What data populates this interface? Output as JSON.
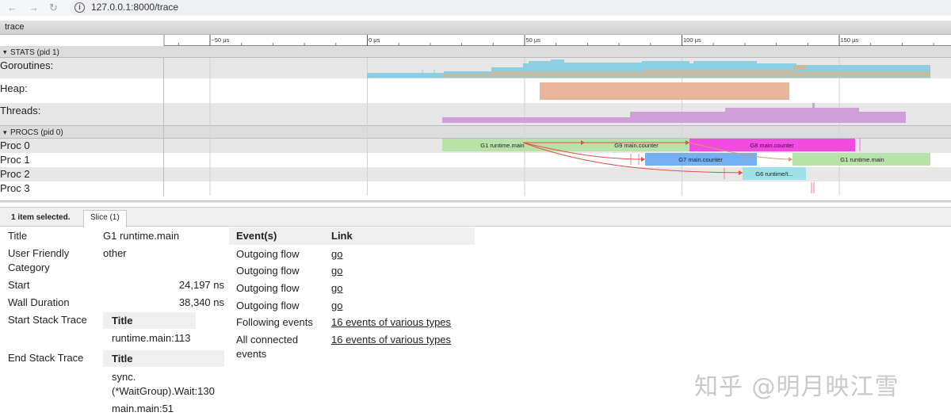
{
  "browser": {
    "url": "127.0.0.1:8000/trace",
    "back_icon": "arrow-left-icon",
    "forward_icon": "arrow-right-icon",
    "reload_icon": "reload-icon",
    "info_icon": "info-icon"
  },
  "trace_title": "trace",
  "ruler": {
    "ticks": [
      {
        "label": "−50 μs",
        "value": -50
      },
      {
        "label": "0 μs",
        "value": 0
      },
      {
        "label": "50 μs",
        "value": 50
      },
      {
        "label": "100 μs",
        "value": 100
      },
      {
        "label": "150 μs",
        "value": 150
      }
    ]
  },
  "stats_header": "STATS (pid 1)",
  "stats_rows": [
    "Goroutines:",
    "Heap:",
    "Threads:"
  ],
  "procs_header": "PROCS (pid 0)",
  "proc_rows": [
    "Proc 0",
    "Proc 1",
    "Proc 2",
    "Proc 3"
  ],
  "slices": [
    {
      "label": "G1 runtime.main",
      "row": 0,
      "color": "#b7e2a8"
    },
    {
      "label": "G9 main.counter",
      "row": 0,
      "color": "#b7e2a8"
    },
    {
      "label": "G8 main.counter",
      "row": 0,
      "color": "#f24be0"
    },
    {
      "label": "G7 main.counter",
      "row": 1,
      "color": "#74b0f2"
    },
    {
      "label": "G1 runtime.main",
      "row": 1,
      "color": "#b7e2a8"
    },
    {
      "label": "G6 runtime/t...",
      "row": 2,
      "color": "#9ee0e6"
    }
  ],
  "colors": {
    "goroutines_running": "#8ccfe3",
    "goroutines_runnable": "#c9b99a",
    "heap": "#e8b49a",
    "threads": "#cf9fd9",
    "flow": "#e0504a",
    "selection_band": "#e7e7e7"
  },
  "panel": {
    "selected_label": "1 item selected.",
    "tab_label": "Slice (1)"
  },
  "details": {
    "title_key": "Title",
    "title_value": "G1 runtime.main",
    "category_key_1": "User Friendly",
    "category_key_2": "Category",
    "category_value": "other",
    "start_key": "Start",
    "start_value": "24,197 ns",
    "wall_key": "Wall Duration",
    "wall_value": "38,340 ns",
    "start_stack_key": "Start Stack Trace",
    "start_stack_header": "Title",
    "start_stack_value": "runtime.main:113",
    "end_stack_key": "End Stack Trace",
    "end_stack_header": "Title",
    "end_stack_values": [
      "sync.",
      "(*WaitGroup).Wait:130",
      "main.main:51"
    ]
  },
  "events": {
    "header_events": "Event(s)",
    "header_link": "Link",
    "rows": [
      {
        "event": "Outgoing flow",
        "link": "go"
      },
      {
        "event": "Outgoing flow",
        "link": "go"
      },
      {
        "event": "Outgoing flow",
        "link": "go"
      },
      {
        "event": "Outgoing flow",
        "link": "go"
      },
      {
        "event": "Following events",
        "link": "16 events of various types"
      },
      {
        "event": "All connected",
        "event2": "events",
        "link": "16 events of various types"
      }
    ]
  },
  "watermark": "知乎 @明月映江雪"
}
